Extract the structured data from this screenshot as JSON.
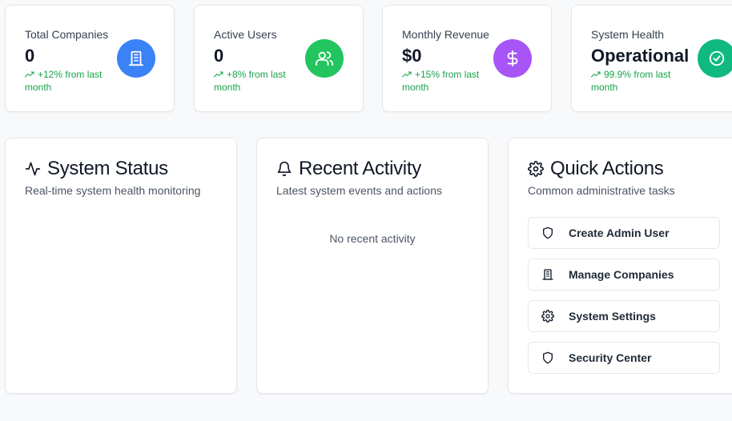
{
  "stats": [
    {
      "title": "Total Companies",
      "value": "0",
      "change": "+12% from last month",
      "icon": "building-icon",
      "color": "#3b82f6"
    },
    {
      "title": "Active Users",
      "value": "0",
      "change": "+8% from last month",
      "icon": "users-icon",
      "color": "#22c55e"
    },
    {
      "title": "Monthly Revenue",
      "value": "$0",
      "change": "+15% from last month",
      "icon": "dollar-icon",
      "color": "#a855f7"
    },
    {
      "title": "System Health",
      "value": "Operational",
      "change": "99.9% from last month",
      "icon": "check-circle-icon",
      "color": "#10b981"
    }
  ],
  "system_status": {
    "title": "System Status",
    "subtitle": "Real-time system health monitoring",
    "icon": "activity-icon"
  },
  "recent_activity": {
    "title": "Recent Activity",
    "subtitle": "Latest system events and actions",
    "empty": "No recent activity",
    "icon": "bell-icon"
  },
  "quick_actions": {
    "title": "Quick Actions",
    "subtitle": "Common administrative tasks",
    "icon": "gear-icon",
    "items": [
      {
        "label": "Create Admin User",
        "icon": "shield-icon"
      },
      {
        "label": "Manage Companies",
        "icon": "building-icon"
      },
      {
        "label": "System Settings",
        "icon": "gear-icon"
      },
      {
        "label": "Security Center",
        "icon": "shield-icon"
      }
    ]
  },
  "colors": {
    "positive": "#16a34a",
    "border": "#e5e7eb",
    "background": "#f8f9fa"
  }
}
